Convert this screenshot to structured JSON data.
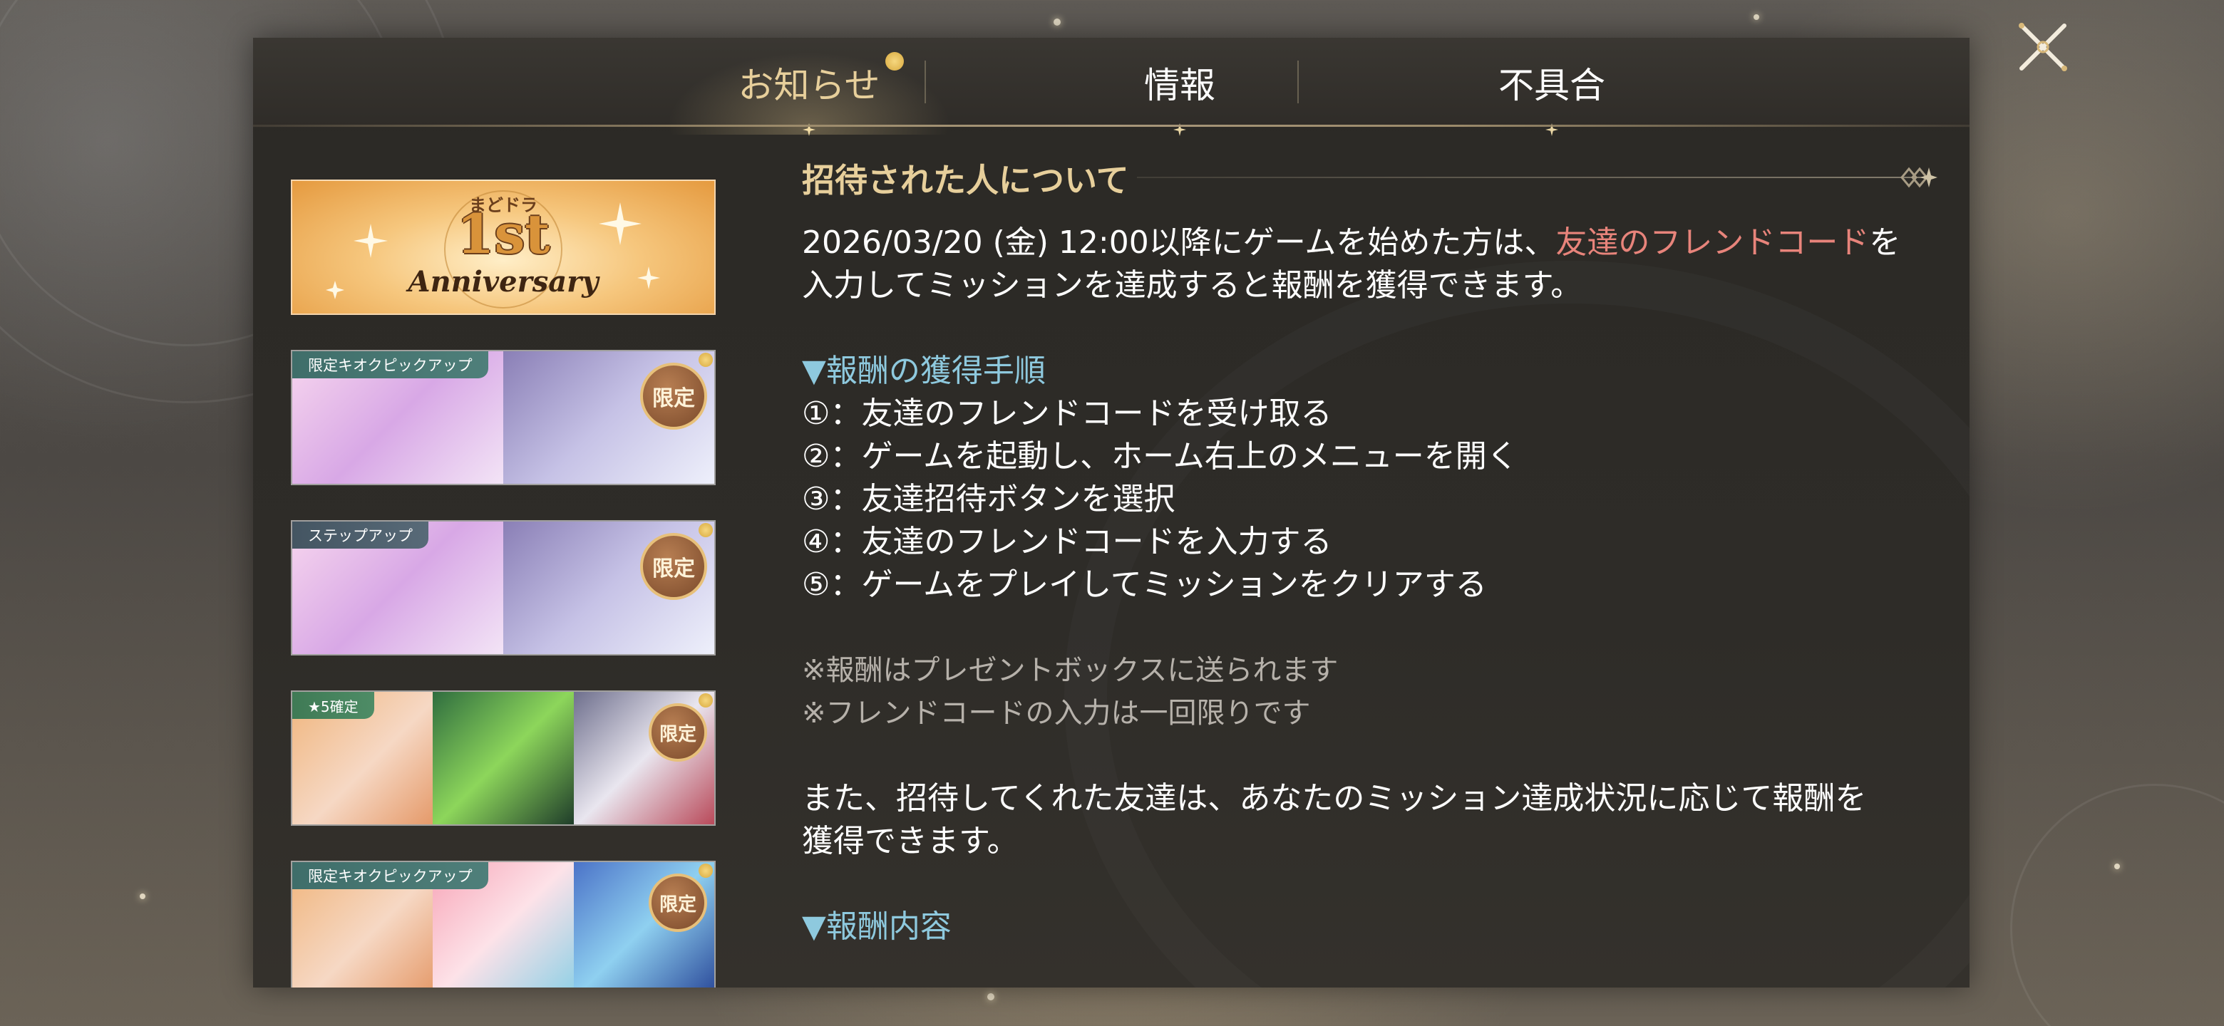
{
  "tabs": [
    {
      "label": "お知らせ",
      "active": true
    },
    {
      "label": "情報",
      "active": false
    },
    {
      "label": "不具合",
      "active": false
    }
  ],
  "banners": [
    {
      "type": "anniversary",
      "small_text": "まどドラ",
      "big_text": "1st",
      "word": "Anniversary"
    },
    {
      "type": "gacha",
      "tag": "限定キオクピックアップ",
      "badge": "限定",
      "new": true
    },
    {
      "type": "gacha",
      "tag": "ステップアップ",
      "badge": "限定",
      "new": true
    },
    {
      "type": "gacha",
      "tag": "★5確定",
      "badge": "限定",
      "new": true
    },
    {
      "type": "gacha",
      "tag": "限定キオクピックアップ",
      "badge": "限定",
      "new": true
    }
  ],
  "article": {
    "title": "招待された人について",
    "intro_before": "2026/03/20 (金) 12:00以降にゲームを始めた方は、",
    "intro_highlight": "友達のフレンドコード",
    "intro_after_line1": "を",
    "intro_line2": "入力してミッションを達成すると報酬を獲得できます。",
    "steps_heading": "▼報酬の獲得手順",
    "steps": [
      "①：友達のフレンドコードを受け取る",
      "②：ゲームを起動し、ホーム右上のメニューを開く",
      "③：友達招待ボタンを選択",
      "④：友達のフレンドコードを入力する",
      "⑤：ゲームをプレイしてミッションをクリアする"
    ],
    "notes": [
      "※報酬はプレゼントボックスに送られます",
      "※フレンドコードの入力は一回限りです"
    ],
    "paragraph_line1": "また、招待してくれた友達は、あなたのミッション達成状況に応じて報酬を",
    "paragraph_line2": "獲得できます。",
    "rewards_heading": "▼報酬内容"
  },
  "colors": {
    "accent_gold": "#e7cf9b",
    "highlight_red": "#e8847b",
    "section_blue": "#8ec9de",
    "note_gray": "#b6b1aa"
  },
  "icons": {
    "close": "close-x-icon",
    "new_marker": "new-dot-icon",
    "tab_star": "sparkle-star-icon"
  }
}
